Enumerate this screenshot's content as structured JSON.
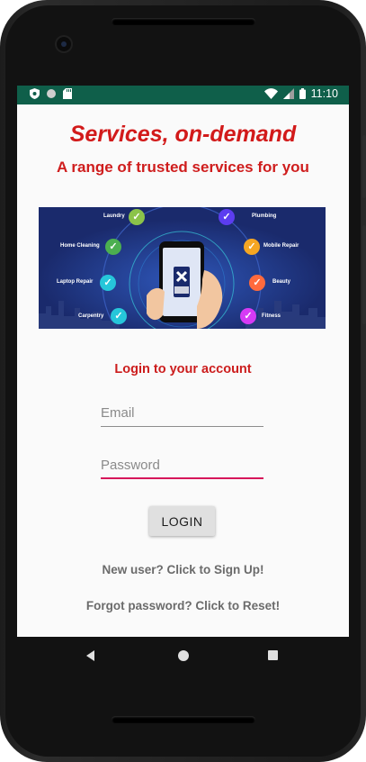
{
  "status_bar": {
    "time": "11:10",
    "icons": [
      "shield-icon",
      "circle-icon",
      "sd-card-icon",
      "wifi-icon",
      "signal-icon",
      "battery-icon"
    ]
  },
  "header": {
    "title": "Services, on-demand",
    "subtitle": "A range of trusted services for you"
  },
  "banner": {
    "services_left": [
      "Laundry",
      "Home Cleaning",
      "Laptop Repair",
      "Carpentry"
    ],
    "services_right": [
      "Plumbing",
      "Mobile Repair",
      "Beauty",
      "Fitness"
    ],
    "check_colors_left": [
      "#8bc34a",
      "#4caf50",
      "#26c6da",
      "#26c6da"
    ],
    "check_colors_right": [
      "#5c3df0",
      "#f5a623",
      "#ff6a3d",
      "#d63af5"
    ]
  },
  "login": {
    "heading": "Login to your account",
    "email_placeholder": "Email",
    "password_placeholder": "Password",
    "button_label": "LOGIN",
    "signup_link": "New user? Click to Sign Up!",
    "reset_link": "Forgot password? Click to Reset!"
  },
  "colors": {
    "accent": "#d21a1a",
    "status_bar": "#0f5f4a",
    "password_underline": "#d6175a"
  }
}
